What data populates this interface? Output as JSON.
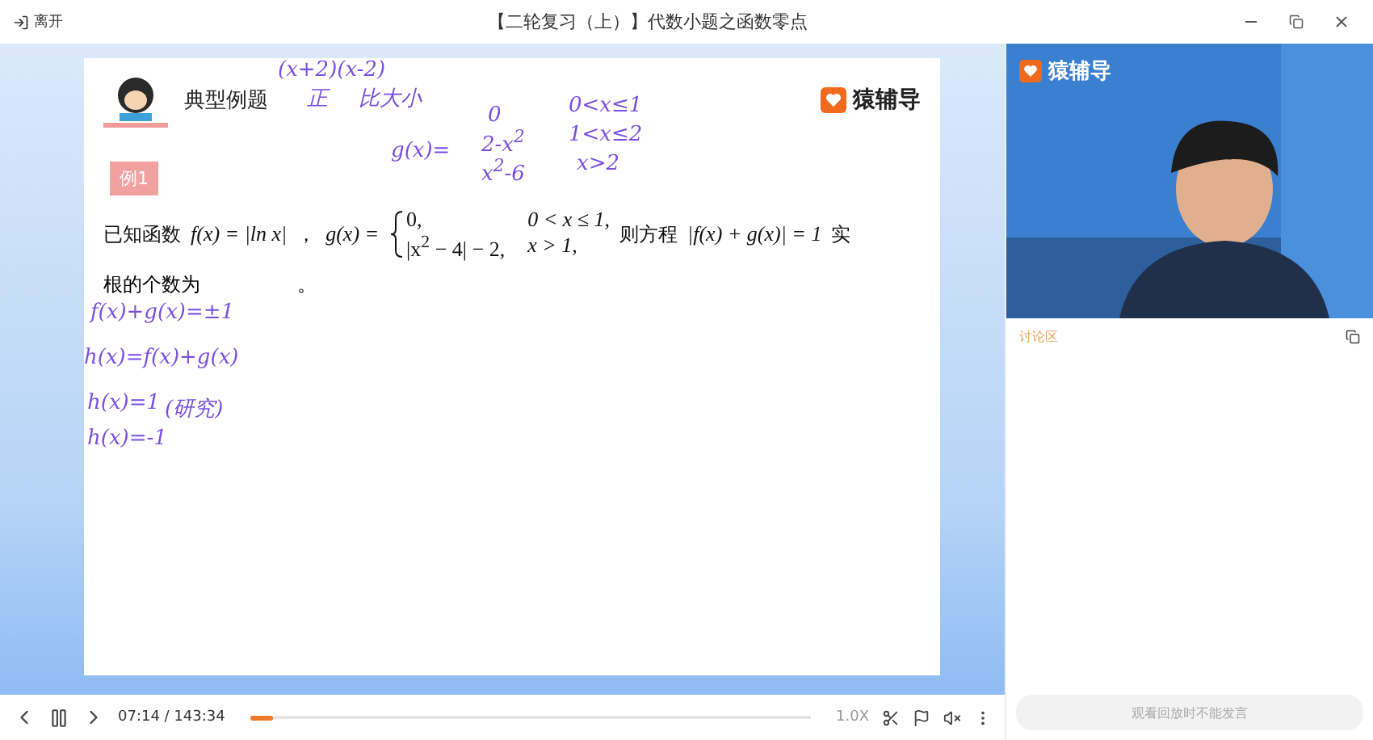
{
  "titlebar": {
    "exit_label": "离开",
    "title": "【二轮复习（上）】代数小题之函数零点"
  },
  "slide": {
    "heading": "典型例题",
    "brand": "猿辅导",
    "badge": "例1",
    "problem": {
      "lead": "已知函数",
      "f": "f(x) = |ln x|",
      "sep": "，",
      "g_label": "g(x) =",
      "cases": [
        {
          "expr": "0,",
          "cond": "0 < x ≤ 1,"
        },
        {
          "expr": "|x$^{2}$ − 4| − 2,",
          "cond": "x > 1,"
        }
      ],
      "then": "则方程",
      "equation": "|f(x) + g(x)| = 1",
      "tail": "实",
      "line2": "根的个数为",
      "end": "。"
    },
    "ink": [
      "(x+2)(x-2)",
      "正",
      "比大小",
      "g(x)=",
      "0",
      "2-x$^{2}$",
      "x$^{2}$-6",
      "0<x≤1",
      "1<x≤2",
      "x>2",
      "f(x)+g(x)=±1",
      "h(x)=f(x)+g(x)",
      "h(x)=1",
      "(研究)",
      "h(x)=-1"
    ]
  },
  "side": {
    "brand": "猿辅导",
    "discussion_label": "讨论区",
    "chat_placeholder": "观看回放时不能发言"
  },
  "player": {
    "time": "07:14 / 143:34",
    "level": 0.04,
    "speed": "1.0X",
    "playing": true
  }
}
